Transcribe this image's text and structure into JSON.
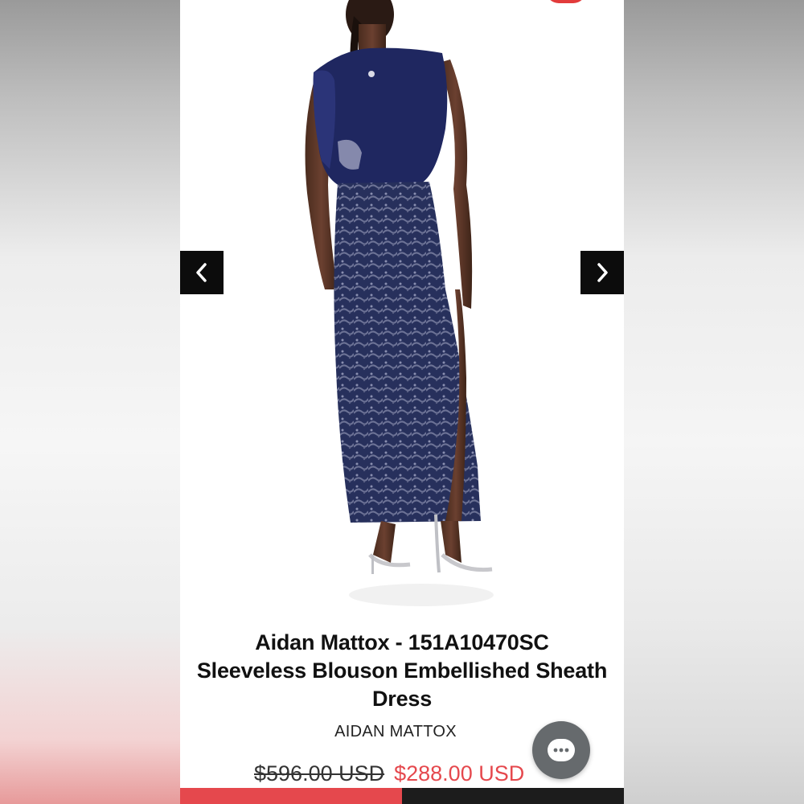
{
  "product": {
    "title_line1": "Aidan Mattox - 151A10470SC",
    "title_line2": "Sleeveless Blouson Embellished Sheath",
    "title_line3": "Dress",
    "vendor": "AIDAN MATTOX",
    "compare_price": "$596.00 USD",
    "sale_price": "$288.00 USD"
  },
  "gallery": {
    "prev_icon": "chevron-left-icon",
    "next_icon": "chevron-right-icon"
  },
  "chat": {
    "icon": "chat-bubble-icon"
  },
  "colors": {
    "sale_price": "#e5484d",
    "accent_bar_left": "#e5484d",
    "accent_bar_right": "#1c1c1c",
    "nav_button": "#0c0c0c",
    "chat_button": "#666a6d"
  }
}
